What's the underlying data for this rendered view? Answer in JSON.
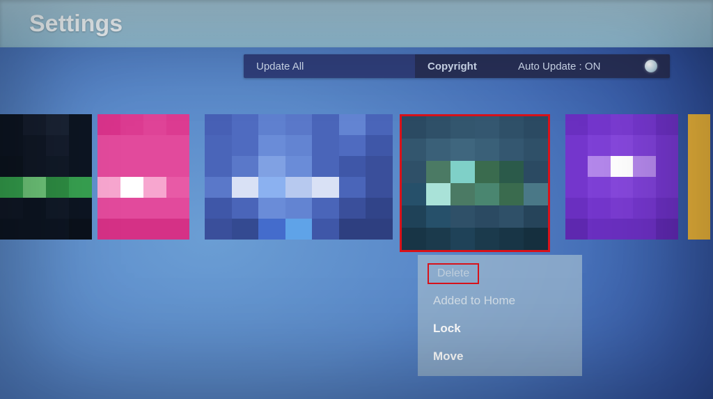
{
  "header": {
    "title": "Settings"
  },
  "toolbar": {
    "update_all": "Update All",
    "copyright": "Copyright",
    "auto_update": "Auto Update : ON"
  },
  "context_menu": {
    "delete": "Delete",
    "added_to_home": "Added to Home",
    "lock": "Lock",
    "move": "Move"
  }
}
